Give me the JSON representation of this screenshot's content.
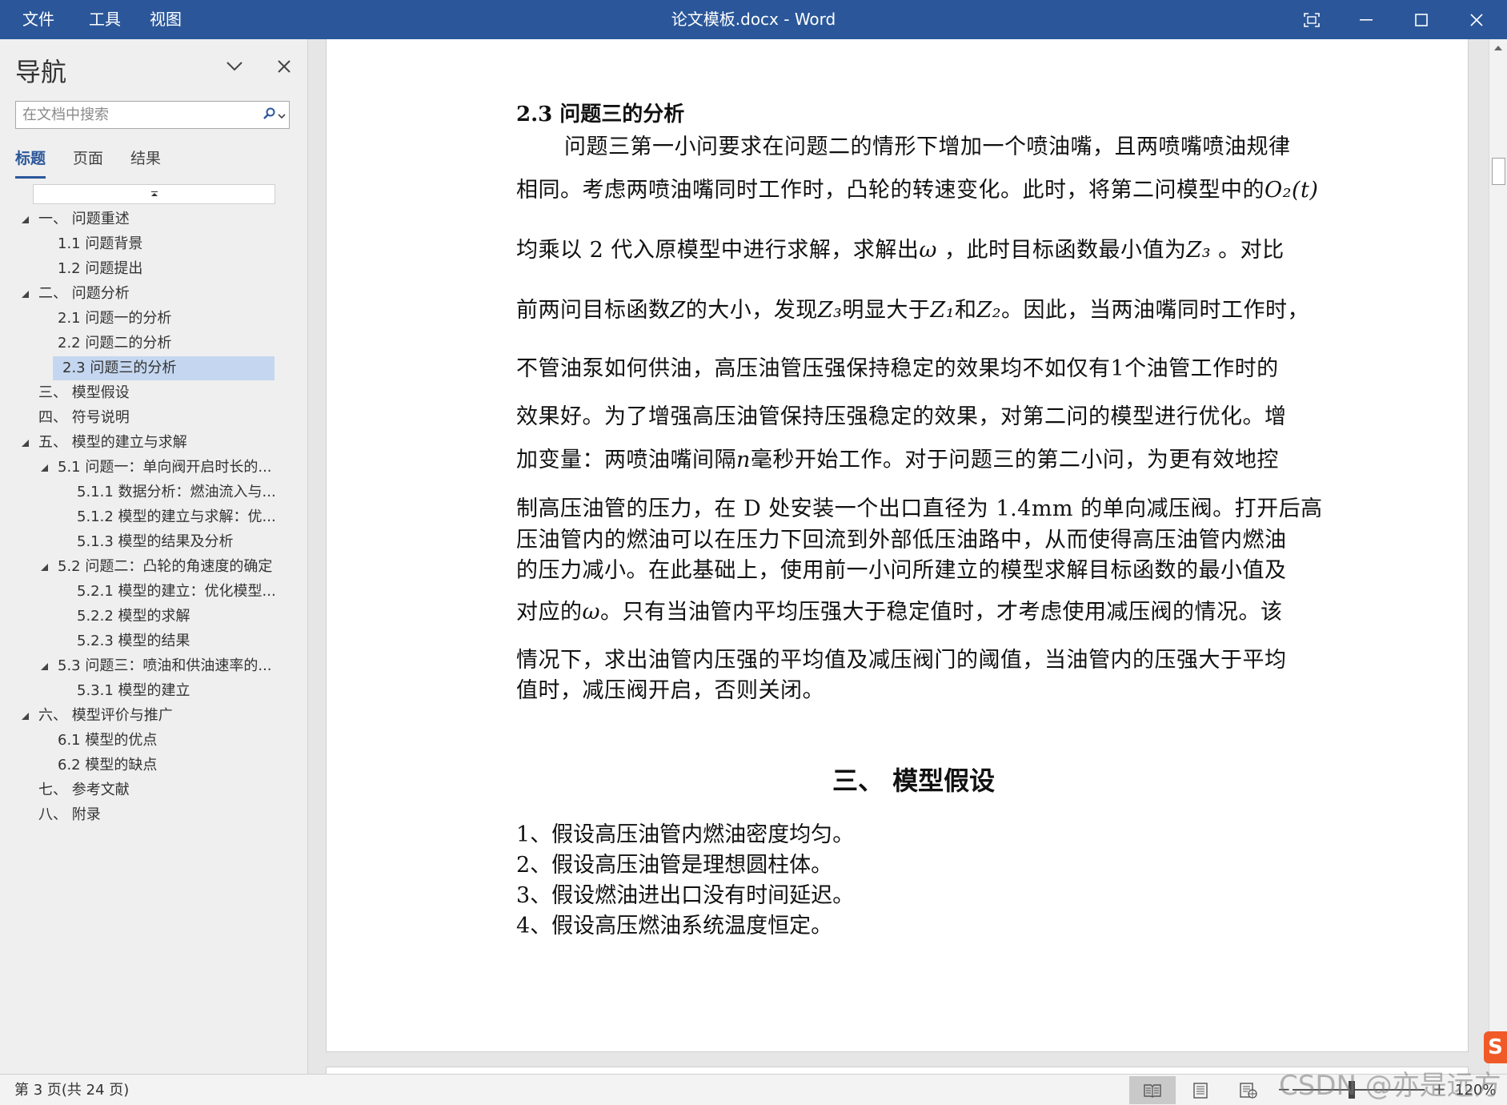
{
  "titlebar": {
    "menu": [
      "文件",
      "工具",
      "视图"
    ],
    "doc_title": "论文模板.docx  -  Word"
  },
  "nav": {
    "title": "导航",
    "search_placeholder": "在文档中搜索",
    "tabs": [
      "标题",
      "页面",
      "结果"
    ],
    "active_tab": "标题",
    "items": [
      {
        "label": "一、 问题重述",
        "level": 1,
        "expanded": true
      },
      {
        "label": "1.1 问题背景",
        "level": 2
      },
      {
        "label": "1.2 问题提出",
        "level": 2
      },
      {
        "label": "二、 问题分析",
        "level": 1,
        "expanded": true
      },
      {
        "label": "2.1 问题一的分析",
        "level": 2
      },
      {
        "label": "2.2 问题二的分析",
        "level": 2
      },
      {
        "label": "2.3 问题三的分析",
        "level": 2,
        "selected": true
      },
      {
        "label": "三、 模型假设",
        "level": 1
      },
      {
        "label": "四、 符号说明",
        "level": 1
      },
      {
        "label": "五、 模型的建立与求解",
        "level": 1,
        "expanded": true
      },
      {
        "label": "5.1 问题一：单向阀开启时长的...",
        "level": 2,
        "expanded": true
      },
      {
        "label": "5.1.1 数据分析：燃油流入与...",
        "level": 3
      },
      {
        "label": "5.1.2 模型的建立与求解：优...",
        "level": 3
      },
      {
        "label": "5.1.3 模型的结果及分析",
        "level": 3
      },
      {
        "label": "5.2 问题二：凸轮的角速度的确定",
        "level": 2,
        "expanded": true
      },
      {
        "label": "5.2.1 模型的建立：优化模型...",
        "level": 3
      },
      {
        "label": "5.2.2 模型的求解",
        "level": 3
      },
      {
        "label": "5.2.3 模型的结果",
        "level": 3
      },
      {
        "label": "5.3 问题三：喷油和供油速率的...",
        "level": 2,
        "expanded": true
      },
      {
        "label": "5.3.1 模型的建立",
        "level": 3
      },
      {
        "label": "六、 模型评价与推广",
        "level": 1,
        "expanded": true
      },
      {
        "label": "6.1 模型的优点",
        "level": 2
      },
      {
        "label": "6.2 模型的缺点",
        "level": 2
      },
      {
        "label": "七、 参考文献",
        "level": 1
      },
      {
        "label": "八、 附录",
        "level": 1
      }
    ]
  },
  "document": {
    "heading": "2.3 问题三的分析",
    "lines": [
      "问题三第一小问要求在问题二的情形下增加一个喷油嘴，且两喷嘴喷油规律",
      "相同。考虑两喷油嘴同时工作时，凸轮的转速变化。此时，将第二问模型中的",
      "均乘以 2 代入原模型中进行求解，求解出",
      "，此时目标函数最小值为",
      "。对比",
      "前两问目标函数",
      "的大小，发现",
      "明显大于",
      "和",
      "。因此，当两油嘴同时工作时，",
      "不管油泵如何供油，高压油管压强保持稳定的效果均不如仅有1个油管工作时的",
      "效果好。为了增强高压油管保持压强稳定的效果，对第二问的模型进行优化。增",
      "加变量：两喷油嘴间隔",
      "毫秒开始工作。对于问题三的第二小问，为更有效地控",
      "制高压油管的压力，在 D 处安装一个出口直径为 1.4mm 的单向减压阀。打开后高",
      "压油管内的燃油可以在压力下回流到外部低压油路中，从而使得高压油管内燃油",
      "的压力减小。在此基础上，使用前一小问所建立的模型求解目标函数的最小值及",
      "对应的",
      "。只有当油管内平均压强大于稳定值时，才考虑使用减压阀的情况。该",
      "情况下，求出油管内压强的平均值及减压阀门的阈值，当油管内的压强大于平均",
      "值时，减压阀开启，否则关闭。"
    ],
    "math": {
      "o2t": "O₂(t)",
      "omega": "ω",
      "z3": "Z₃",
      "z": "Z",
      "z1": "Z₁",
      "z2": "Z₂",
      "n": "n"
    },
    "section_heading": "三、  模型假设",
    "assumptions": [
      "1、假设高压油管内燃油密度均匀。",
      "2、假设高压油管是理想圆柱体。",
      "3、假设燃油进出口没有时间延迟。",
      "4、假设高压燃油系统温度恒定。"
    ]
  },
  "status": {
    "page_info": "第 3 页(共 24 页)",
    "zoom_minus": "−",
    "zoom_plus": "+",
    "zoom_level": "120%",
    "zoom_fraction": 0.45
  },
  "watermark": "CSDN @亦是远方",
  "ime_badge": "S",
  "colors": {
    "titlebar": "#2b579a",
    "selected_item": "#c5d7f0",
    "accent": "#2b579a"
  }
}
